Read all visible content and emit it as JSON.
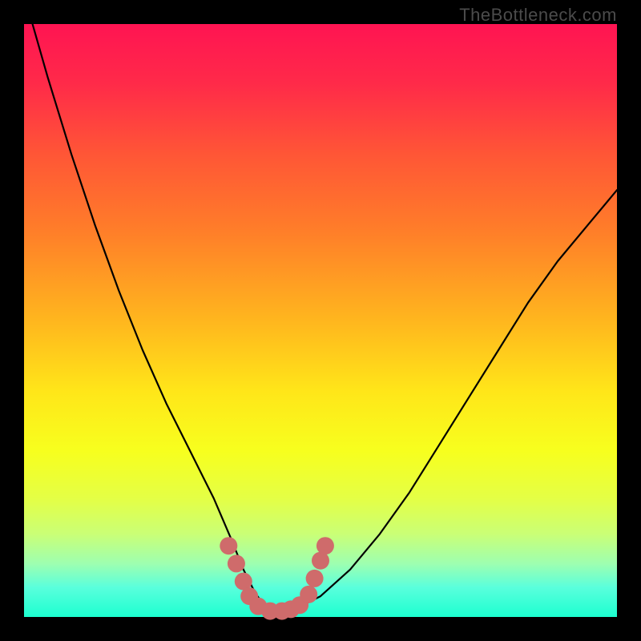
{
  "watermark_text": "TheBottleneck.com",
  "gradient": {
    "stops": [
      {
        "offset": "0%",
        "color": "#ff1452"
      },
      {
        "offset": "10%",
        "color": "#ff2a49"
      },
      {
        "offset": "22%",
        "color": "#ff5636"
      },
      {
        "offset": "35%",
        "color": "#ff7e29"
      },
      {
        "offset": "50%",
        "color": "#ffb61e"
      },
      {
        "offset": "62%",
        "color": "#ffe619"
      },
      {
        "offset": "72%",
        "color": "#f7ff1e"
      },
      {
        "offset": "80%",
        "color": "#e4ff45"
      },
      {
        "offset": "86%",
        "color": "#caff76"
      },
      {
        "offset": "91%",
        "color": "#9effb0"
      },
      {
        "offset": "95%",
        "color": "#5affdc"
      },
      {
        "offset": "100%",
        "color": "#1cffd0"
      }
    ]
  },
  "chart_data": {
    "type": "line",
    "title": "",
    "xlabel": "",
    "ylabel": "",
    "xlim": [
      0,
      100
    ],
    "ylim": [
      0,
      100
    ],
    "series": [
      {
        "name": "bottleneck-curve",
        "x": [
          0,
          4,
          8,
          12,
          16,
          20,
          24,
          28,
          32,
          35,
          37,
          39,
          40.5,
          42,
          44,
          46,
          50,
          55,
          60,
          65,
          70,
          75,
          80,
          85,
          90,
          95,
          100
        ],
        "y": [
          105,
          91,
          78,
          66,
          55,
          45,
          36,
          28,
          20,
          13,
          8,
          4,
          2,
          1.2,
          1,
          1.5,
          3.5,
          8,
          14,
          21,
          29,
          37,
          45,
          53,
          60,
          66,
          72
        ]
      }
    ],
    "markers": {
      "name": "highlight-dots",
      "color": "#cf6b6b",
      "points": [
        {
          "x": 34.5,
          "y": 12
        },
        {
          "x": 35.8,
          "y": 9
        },
        {
          "x": 37.0,
          "y": 6
        },
        {
          "x": 38.0,
          "y": 3.5
        },
        {
          "x": 39.5,
          "y": 1.8
        },
        {
          "x": 41.5,
          "y": 1.0
        },
        {
          "x": 43.5,
          "y": 1.0
        },
        {
          "x": 45.0,
          "y": 1.3
        },
        {
          "x": 46.5,
          "y": 2.0
        },
        {
          "x": 48.0,
          "y": 3.8
        },
        {
          "x": 49.0,
          "y": 6.5
        },
        {
          "x": 50.0,
          "y": 9.5
        },
        {
          "x": 50.8,
          "y": 12.0
        }
      ]
    }
  }
}
